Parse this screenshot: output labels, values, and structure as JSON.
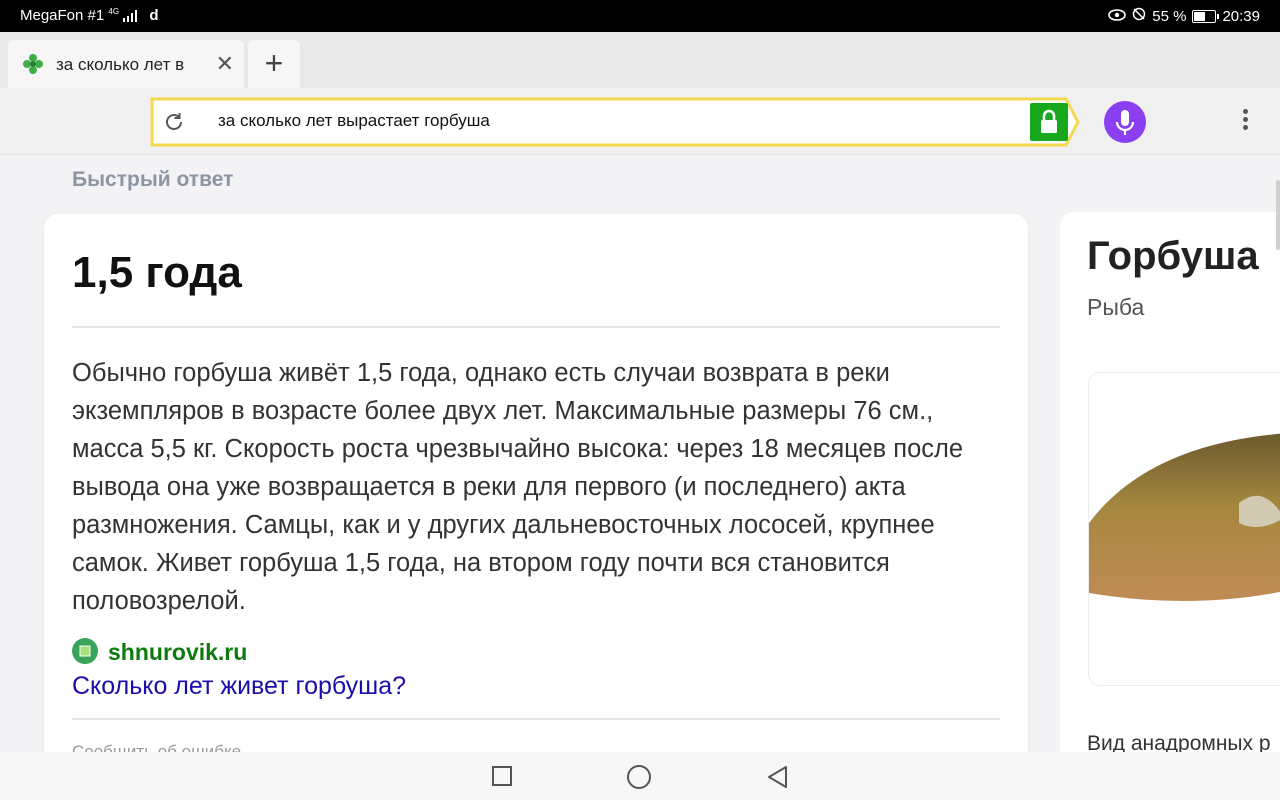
{
  "status_bar": {
    "carrier": "MegaFon #1",
    "network": "4G",
    "extra": "d",
    "battery": "55 %",
    "battery_level": 0.55,
    "time": "20:39"
  },
  "tab": {
    "title": "за сколько лет в",
    "new_tab": "+",
    "close": "✕"
  },
  "address_bar": {
    "query": "за сколько лет вырастает горбуша"
  },
  "quick_answer": {
    "section_label": "Быстрый ответ",
    "answer": "1,5 года",
    "text": "Обычно горбуша живёт 1,5 года, однако есть случаи возврата в реки экземпляров в возрасте более двух лет. Максимальные размеры 76 см., масса 5,5 кг. Скорость роста чрезвычайно высока: через 18 месяцев после вывода она уже возвращается в реки для первого (и последнего) акта размножения. Самцы, как и у других дальневосточных лососей, крупнее самок. Живет горбуша 1,5 года, на втором году почти вся становится половозрелой.",
    "source_domain": "shnurovik.ru",
    "source_title": "Сколько лет живет горбуша?",
    "report": "Сообщить об ошибке"
  },
  "entity_card": {
    "title": "Горбуша",
    "subtitle": "Рыба",
    "description": "Вид анадромных р"
  },
  "colors": {
    "accent_yellow": "#f2d94e",
    "lock_green": "#18a81e",
    "mic_purple": "#8a3ff0",
    "source_green": "#0d7a0d",
    "link_blue": "#1a0dab"
  }
}
